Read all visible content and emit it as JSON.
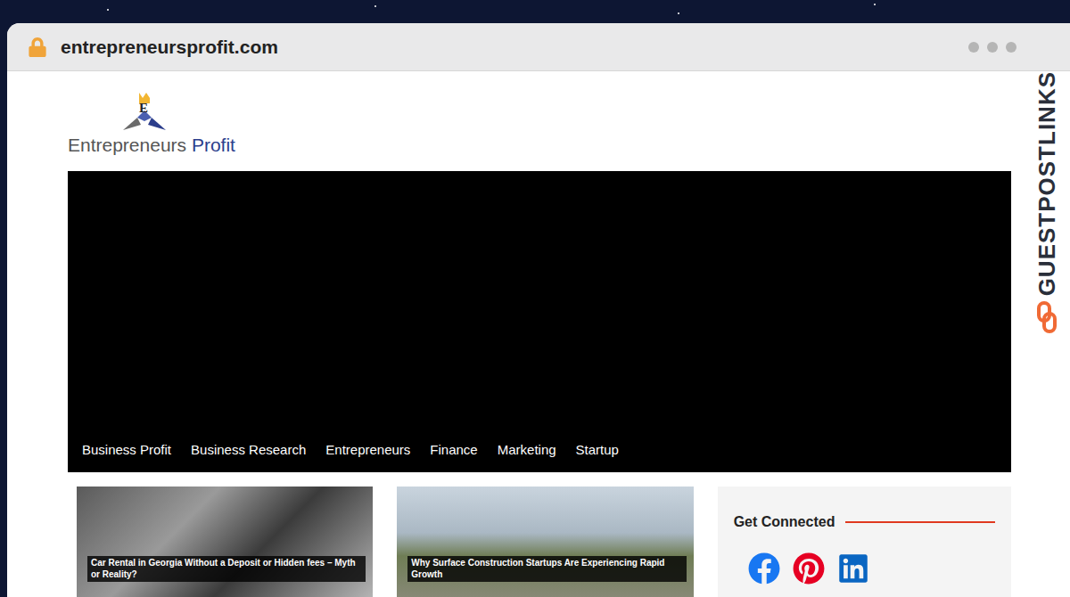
{
  "browser": {
    "url": "entrepreneursprofit.com"
  },
  "watermark": "GUESTPOSTLINKS",
  "logo": {
    "letter": "E",
    "name_first": "Entrepreneurs",
    "name_second": "Profit"
  },
  "nav": [
    "Business Profit",
    "Business Research",
    "Entrepreneurs",
    "Finance",
    "Marketing",
    "Startup"
  ],
  "posts": [
    {
      "title": "Car Rental in Georgia Without a Deposit or Hidden fees – Myth or Reality?"
    },
    {
      "title": "Why Surface Construction Startups Are Experiencing Rapid Growth"
    }
  ],
  "sidebar": {
    "title": "Get Connected"
  }
}
